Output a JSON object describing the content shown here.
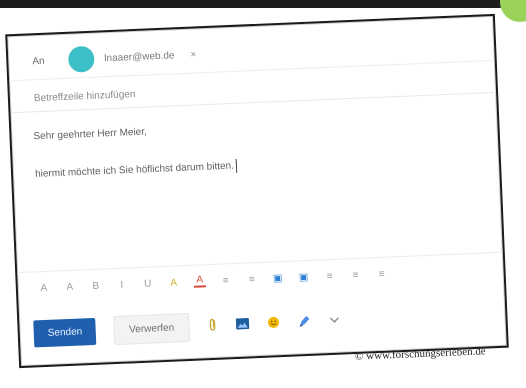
{
  "email": {
    "to_label": "An",
    "recipient": "lnaaer@web.de",
    "remove_symbol": "×",
    "subject_placeholder": "Betreffzeile hinzufügen",
    "body": {
      "greeting": "Sehr geehrter Herr Meier,",
      "line": "hiermit möchte ich Sie höflichst darum bitten."
    }
  },
  "formatting": {
    "items": [
      "A",
      "A",
      "B",
      "I",
      "U",
      "A",
      "A",
      "≡",
      "≡",
      "▣",
      "▣",
      "≡",
      "≡",
      "≡"
    ]
  },
  "actions": {
    "send_label": "Senden",
    "discard_label": "Verwerfen",
    "attach_icon": "paperclip-icon",
    "image_icon": "image-icon",
    "emoji_icon": "emoji-icon",
    "draw_icon": "pen-icon",
    "more_icon": "chevron-down-icon"
  },
  "watermark": "© www.forschungserleben.de"
}
